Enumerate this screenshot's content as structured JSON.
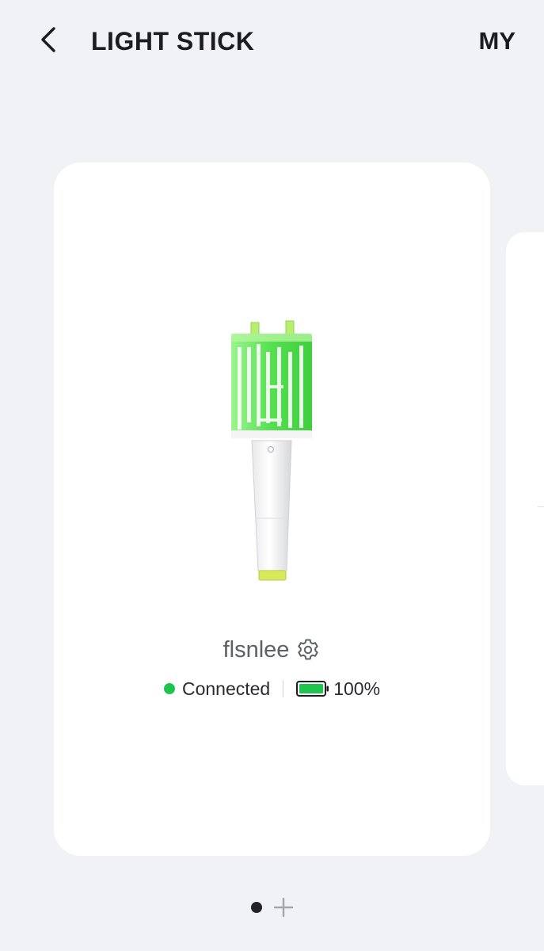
{
  "header": {
    "title": "LIGHT STICK",
    "my_label": "MY",
    "back_icon": "chevron-left-icon"
  },
  "device": {
    "name": "flsnlee",
    "settings_icon": "gear-icon",
    "status": "Connected",
    "status_color": "#1fc44e",
    "battery_level": 1.0,
    "battery_text": "100%",
    "battery_color": "#1fc44e",
    "lightstick_glow_color": "#5ee85a"
  },
  "pager": {
    "total_pages": 1,
    "current_page": 1,
    "add_icon": "plus-icon"
  }
}
